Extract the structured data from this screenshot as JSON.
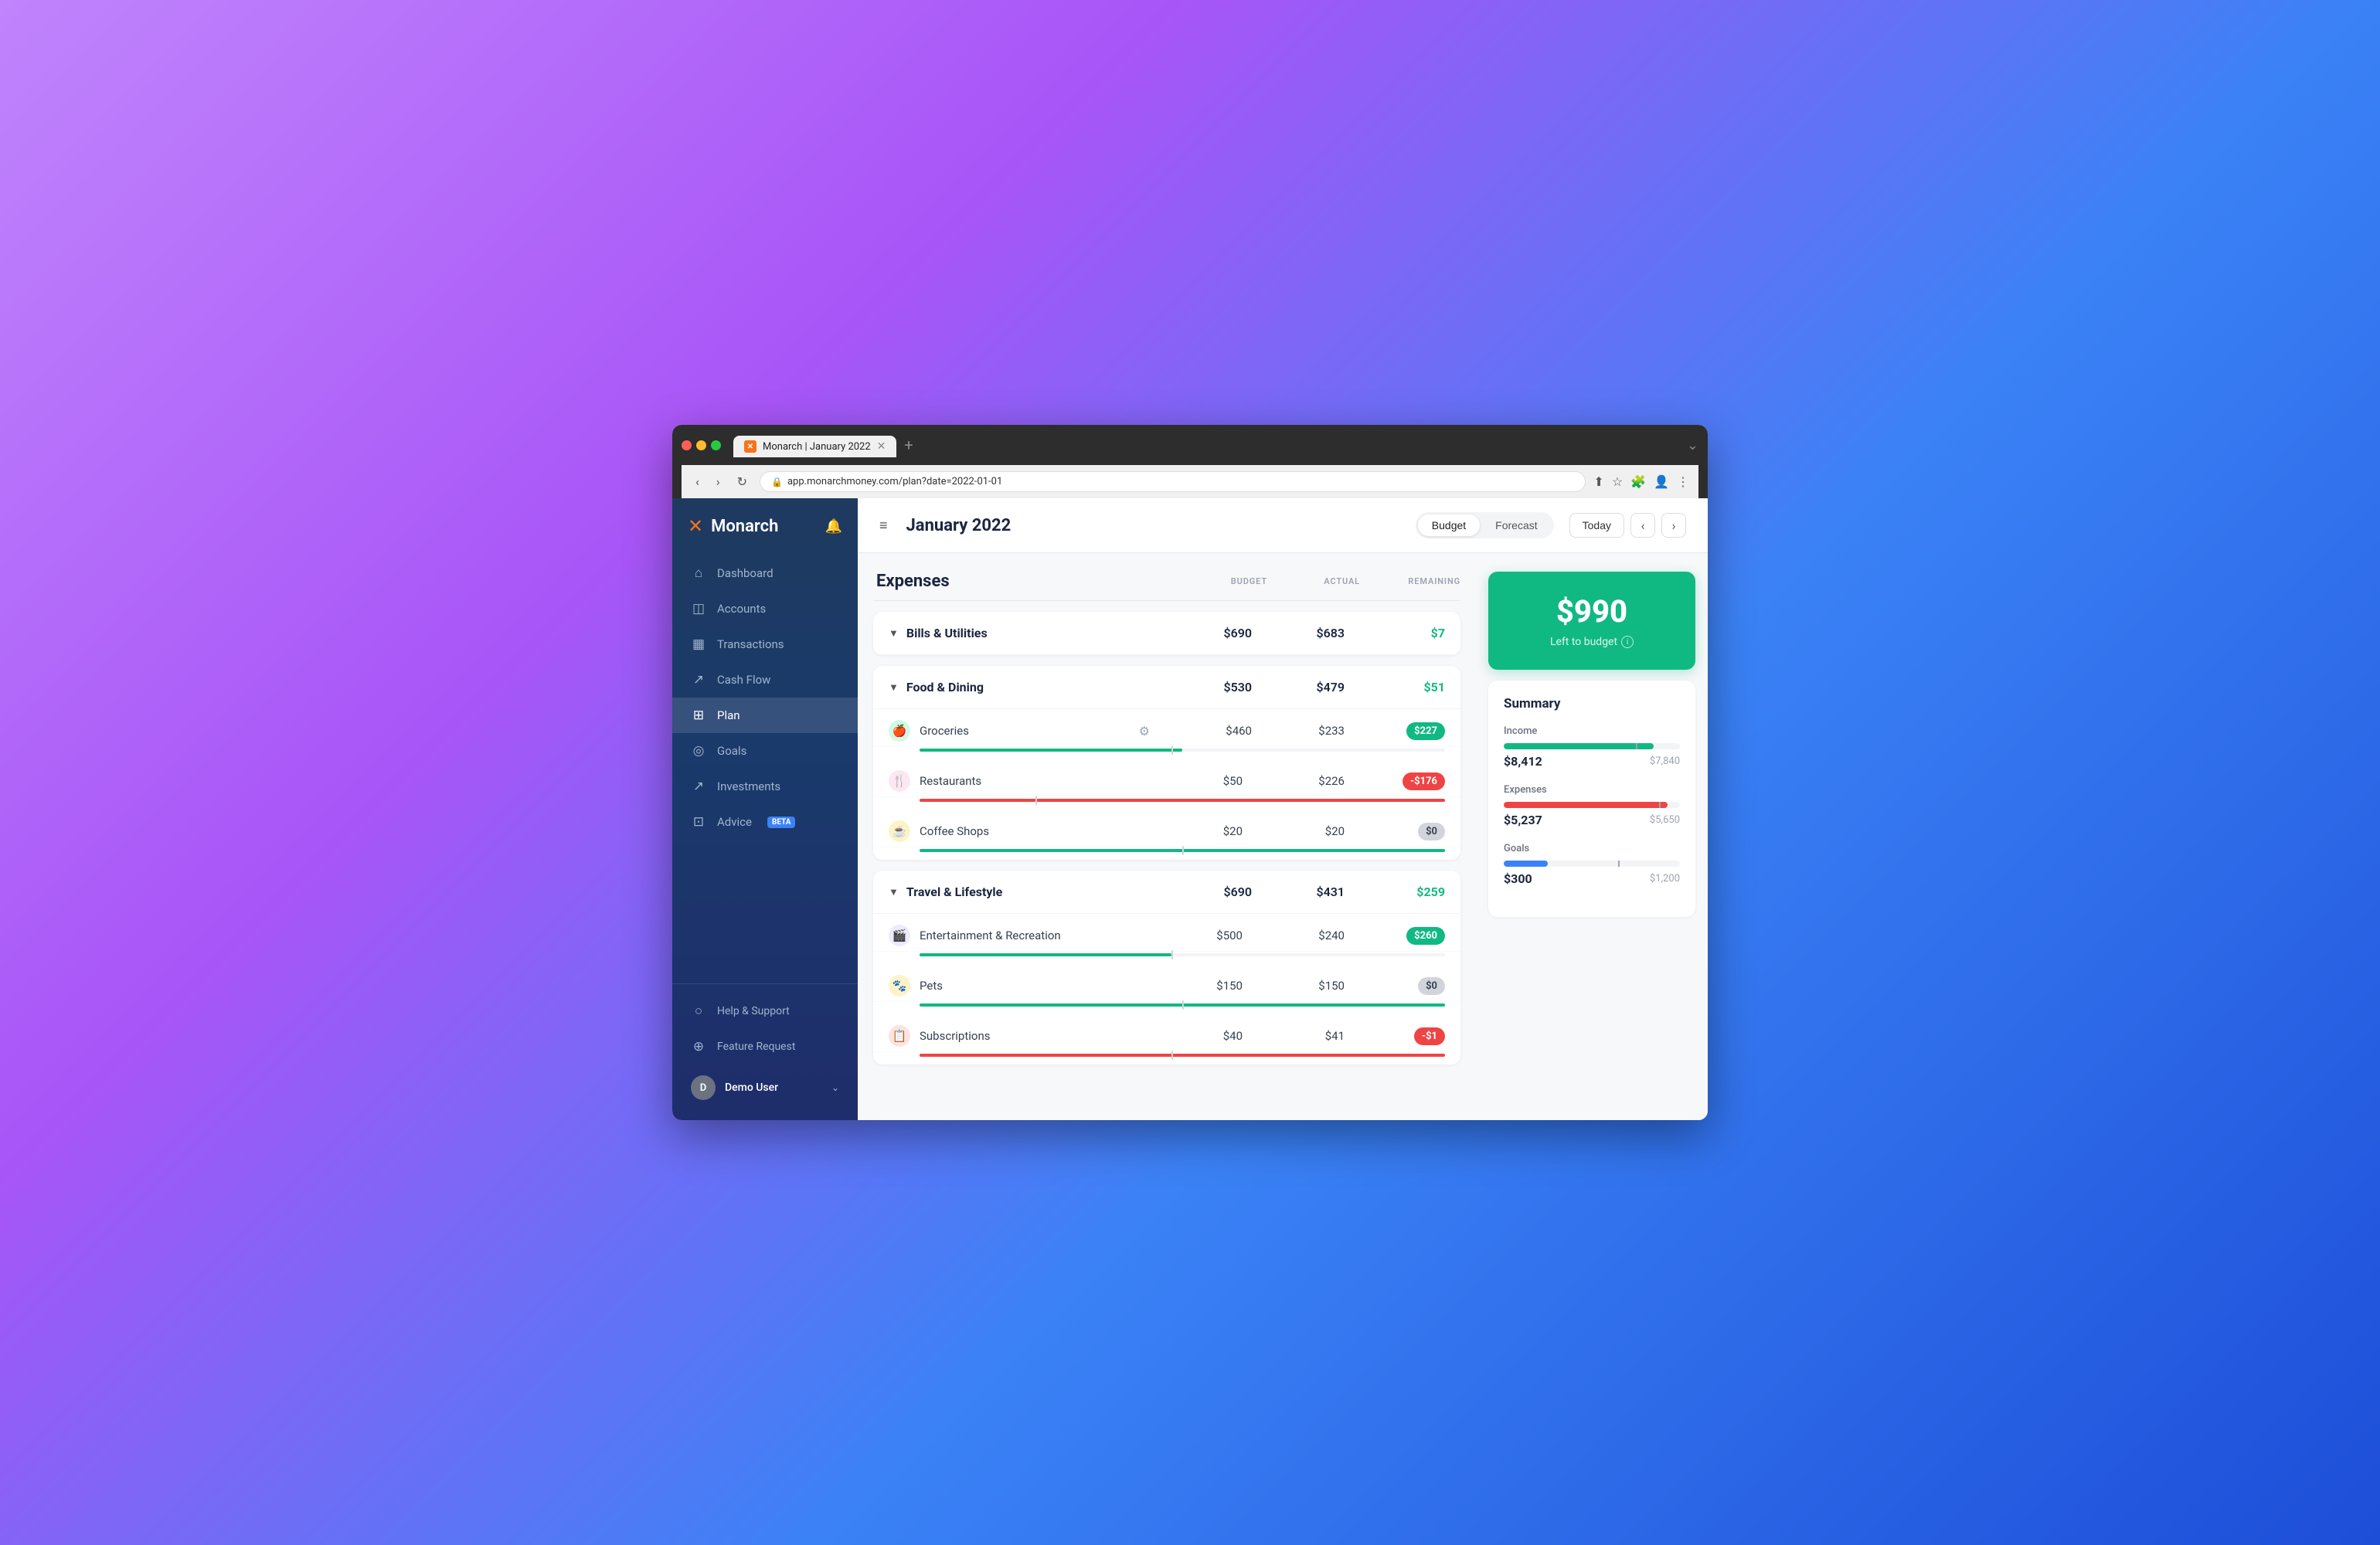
{
  "browser": {
    "tab_favicon": "✕",
    "tab_title": "Monarch | January 2022",
    "tab_close": "✕",
    "new_tab": "+",
    "nav_back": "‹",
    "nav_forward": "›",
    "nav_refresh": "↻",
    "address": "app.monarchmoney.com/plan?date=2022-01-01",
    "nav_chevron": "⌄"
  },
  "sidebar": {
    "logo_text": "Monarch",
    "logo_symbol": "✕",
    "items": [
      {
        "id": "dashboard",
        "label": "Dashboard",
        "icon": "⌂"
      },
      {
        "id": "accounts",
        "label": "Accounts",
        "icon": "◫"
      },
      {
        "id": "transactions",
        "label": "Transactions",
        "icon": "▦"
      },
      {
        "id": "cashflow",
        "label": "Cash Flow",
        "icon": "↗"
      },
      {
        "id": "plan",
        "label": "Plan",
        "icon": "⊞",
        "active": true
      },
      {
        "id": "goals",
        "label": "Goals",
        "icon": "◎"
      },
      {
        "id": "investments",
        "label": "Investments",
        "icon": "↗"
      },
      {
        "id": "advice",
        "label": "Advice",
        "icon": "⊡",
        "badge": "BETA"
      }
    ],
    "bottom_items": [
      {
        "id": "help",
        "label": "Help & Support",
        "icon": "○"
      },
      {
        "id": "feature",
        "label": "Feature Request",
        "icon": "⊕"
      }
    ],
    "user": {
      "name": "Demo User",
      "initials": "D"
    }
  },
  "header": {
    "menu_icon": "≡",
    "title": "January 2022",
    "toggle_budget": "Budget",
    "toggle_forecast": "Forecast",
    "today_label": "Today",
    "prev_arrow": "‹",
    "next_arrow": "›"
  },
  "expenses": {
    "title": "Expenses",
    "columns": {
      "budget": "BUDGET",
      "actual": "ACTUAL",
      "remaining": "REMAINING"
    },
    "groups": [
      {
        "id": "bills",
        "name": "Bills & Utilities",
        "budget": "$690",
        "actual": "$683",
        "remaining": "$7",
        "remaining_positive": true,
        "items": []
      },
      {
        "id": "food",
        "name": "Food & Dining",
        "budget": "$530",
        "actual": "$479",
        "remaining": "$51",
        "remaining_positive": true,
        "items": [
          {
            "id": "groceries",
            "name": "Groceries",
            "icon": "🍎",
            "icon_bg": "#d1fae5",
            "budget": "$460",
            "actual": "$233",
            "remaining": "$227",
            "badge_type": "green",
            "progress_pct": 50,
            "marker_pct": 48,
            "bar_color": "#10b981",
            "has_gear": true
          },
          {
            "id": "restaurants",
            "name": "Restaurants",
            "icon": "🍴",
            "icon_bg": "#fce7f3",
            "budget": "$50",
            "actual": "$226",
            "remaining": "-$176",
            "badge_type": "red",
            "progress_pct": 100,
            "marker_pct": 22,
            "bar_color": "#ef4444",
            "has_gear": false
          },
          {
            "id": "coffee",
            "name": "Coffee Shops",
            "icon": "☕",
            "icon_bg": "#fef3c7",
            "budget": "$20",
            "actual": "$20",
            "remaining": "$0",
            "badge_type": "gray",
            "progress_pct": 100,
            "marker_pct": 50,
            "bar_color": "#10b981",
            "has_gear": false
          }
        ]
      },
      {
        "id": "travel",
        "name": "Travel & Lifestyle",
        "budget": "$690",
        "actual": "$431",
        "remaining": "$259",
        "remaining_positive": true,
        "items": [
          {
            "id": "entertainment",
            "name": "Entertainment & Recreation",
            "icon": "🎬",
            "icon_bg": "#ede9fe",
            "budget": "$500",
            "actual": "$240",
            "remaining": "$260",
            "badge_type": "green",
            "progress_pct": 48,
            "marker_pct": 48,
            "bar_color": "#10b981",
            "has_gear": false
          },
          {
            "id": "pets",
            "name": "Pets",
            "icon": "🐾",
            "icon_bg": "#fef3c7",
            "budget": "$150",
            "actual": "$150",
            "remaining": "$0",
            "badge_type": "gray",
            "progress_pct": 100,
            "marker_pct": 50,
            "bar_color": "#10b981",
            "has_gear": false
          },
          {
            "id": "subscriptions",
            "name": "Subscriptions",
            "icon": "📋",
            "icon_bg": "#fee2e2",
            "budget": "$40",
            "actual": "$41",
            "remaining": "-$1",
            "badge_type": "red",
            "progress_pct": 100,
            "marker_pct": 48,
            "bar_color": "#ef4444",
            "has_gear": false
          }
        ]
      }
    ]
  },
  "right_panel": {
    "left_to_budget": {
      "amount": "$990",
      "label": "Left to budget"
    },
    "summary": {
      "title": "Summary",
      "income": {
        "label": "Income",
        "actual": "$8,412",
        "budget": "$7,840",
        "fill_pct": 85,
        "marker_pct": 75
      },
      "expenses": {
        "label": "Expenses",
        "actual": "$5,237",
        "budget": "$5,650",
        "fill_pct": 93,
        "marker_pct": 88
      },
      "goals": {
        "label": "Goals",
        "actual": "$300",
        "budget": "$1,200",
        "fill_pct": 25,
        "marker_pct": 65
      }
    }
  }
}
